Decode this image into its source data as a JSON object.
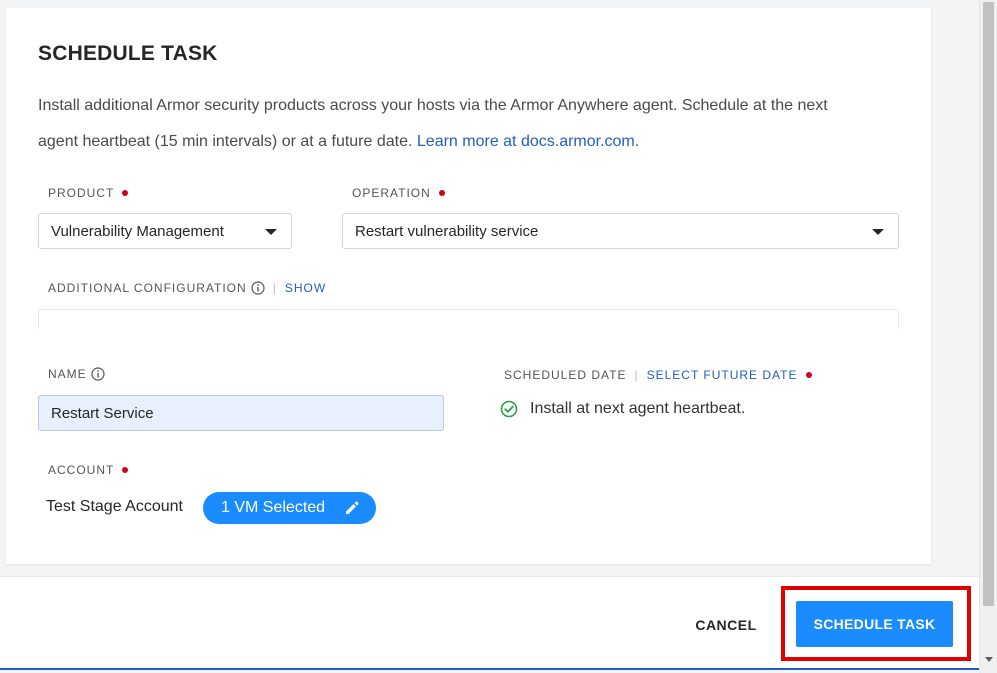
{
  "dialog": {
    "title": "SCHEDULE TASK",
    "description": "Install additional Armor security products across your hosts via the Armor Anywhere agent. Schedule at the next agent heartbeat (15 min intervals) or at a future date. ",
    "learn_more_link": "Learn more at docs.armor.com",
    "description_end": "."
  },
  "product": {
    "label": "PRODUCT",
    "value": "Vulnerability Management"
  },
  "operation": {
    "label": "OPERATION",
    "value": "Restart vulnerability service"
  },
  "additional_config": {
    "label": "ADDITIONAL CONFIGURATION",
    "toggle_label": "SHOW"
  },
  "name": {
    "label": "NAME",
    "value": "Restart Service"
  },
  "scheduled_date": {
    "label": "SCHEDULED DATE",
    "link_label": "SELECT FUTURE DATE",
    "status_text": "Install at next agent heartbeat."
  },
  "account": {
    "label": "ACCOUNT",
    "name": "Test Stage Account",
    "vm_selection": "1 VM Selected"
  },
  "footer": {
    "cancel_label": "CANCEL",
    "submit_label": "SCHEDULE TASK"
  },
  "colors": {
    "accent": "#1a8cff",
    "link": "#1f5fbf",
    "required": "#d0021b",
    "success": "#2e9e44",
    "highlight": "#e00000"
  },
  "icons": {
    "info": "info-icon",
    "caret": "chevron-down-icon",
    "check": "check-circle-icon",
    "edit": "pencil-icon"
  }
}
